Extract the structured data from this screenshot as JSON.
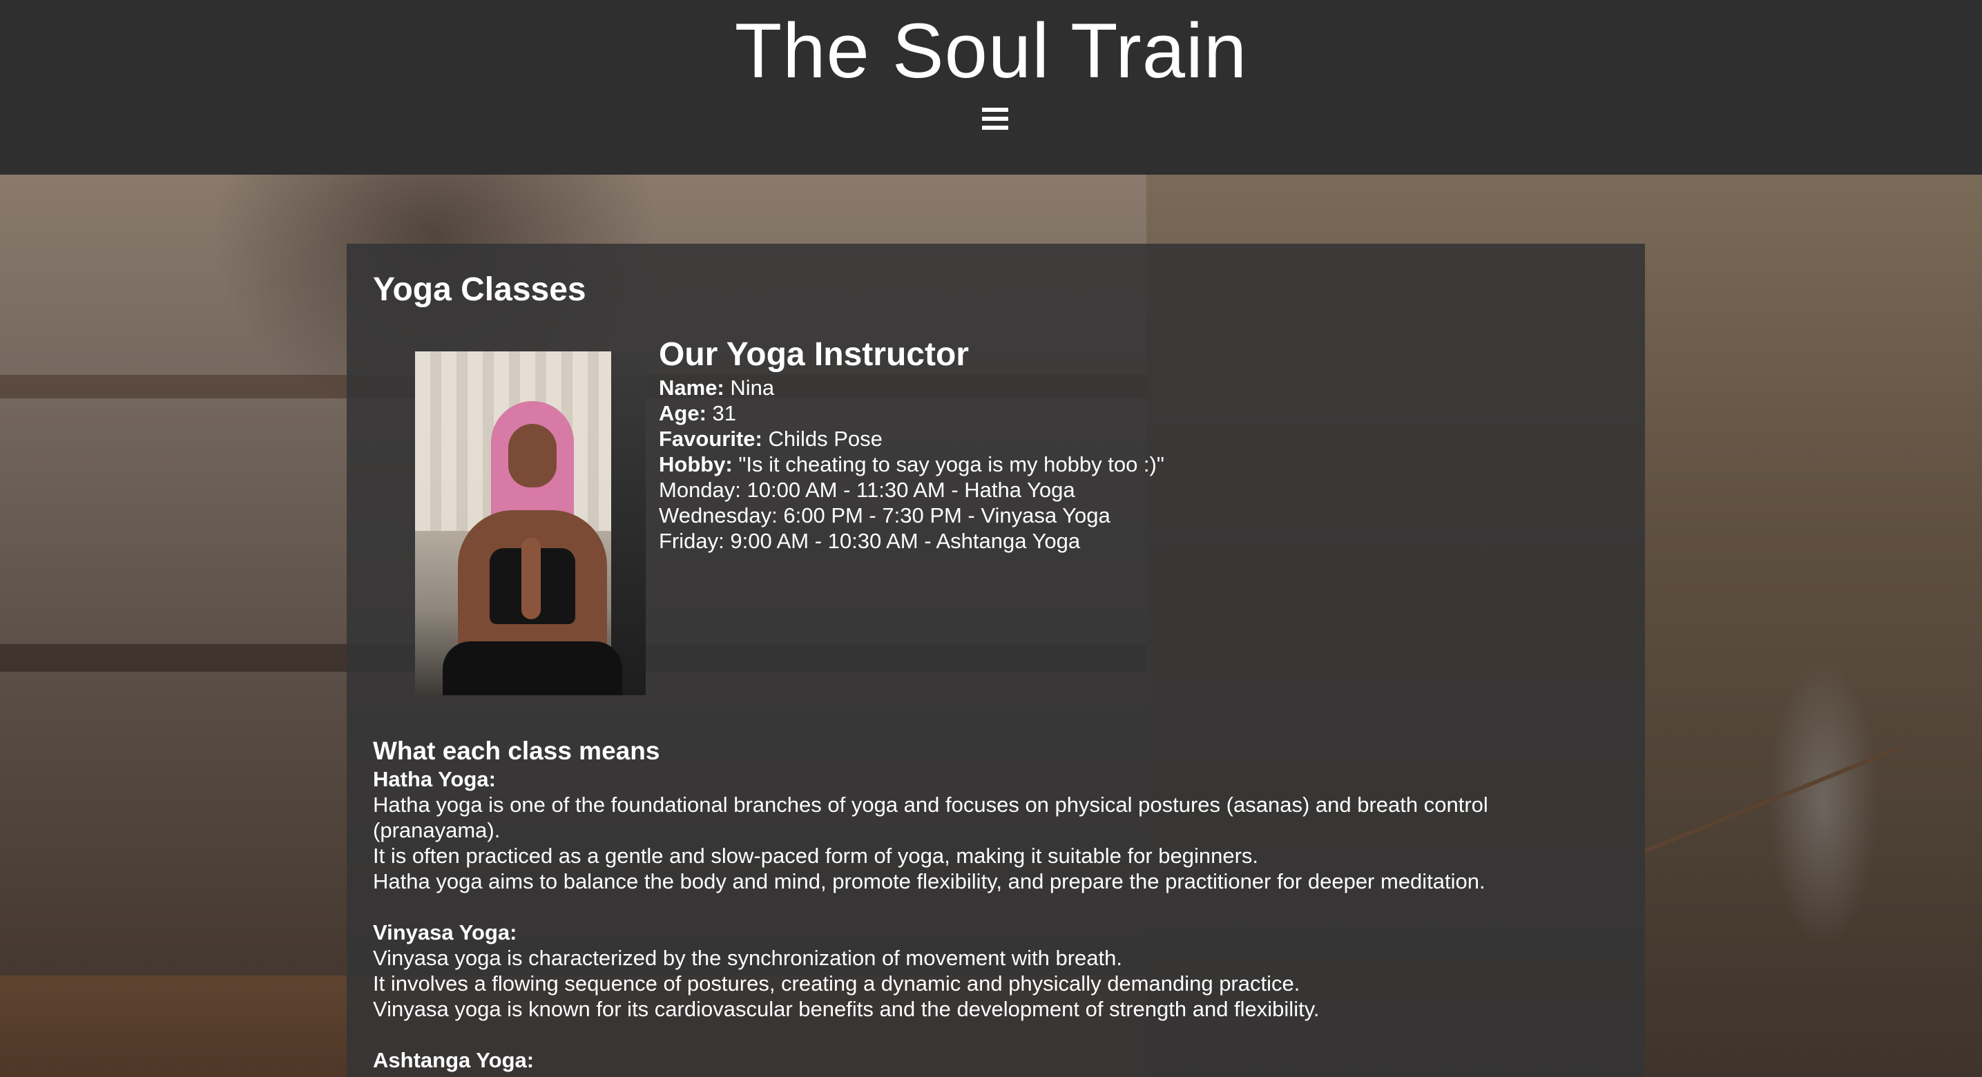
{
  "header": {
    "title": "The Soul Train",
    "menu_icon": "hamburger-menu-icon"
  },
  "main": {
    "section_title": "Yoga Classes",
    "instructor": {
      "heading": "Our Yoga Instructor",
      "name_label": "Name:",
      "name": "Nina",
      "age_label": "Age:",
      "age": "31",
      "favourite_label": "Favourite:",
      "favourite": "Childs Pose",
      "hobby_label": "Hobby:",
      "hobby": "\"Is it cheating to say yoga is my hobby too :)\"",
      "schedule": [
        "Monday: 10:00 AM - 11:30 AM - Hatha Yoga",
        "Wednesday: 6:00 PM - 7:30 PM - Vinyasa Yoga",
        "Friday: 9:00 AM - 10:30 AM - Ashtanga Yoga"
      ]
    },
    "classes": {
      "heading": "What each class means",
      "items": [
        {
          "name": "Hatha Yoga:",
          "lines": [
            "Hatha yoga is one of the foundational branches of yoga and focuses on physical postures (asanas) and breath control",
            "(pranayama).",
            "It is often practiced as a gentle and slow-paced form of yoga, making it suitable for beginners.",
            "Hatha yoga aims to balance the body and mind, promote flexibility, and prepare the practitioner for deeper meditation."
          ]
        },
        {
          "name": "Vinyasa Yoga:",
          "lines": [
            "Vinyasa yoga is characterized by the synchronization of movement with breath.",
            "It involves a flowing sequence of postures, creating a dynamic and physically demanding practice.",
            "Vinyasa yoga is known for its cardiovascular benefits and the development of strength and flexibility."
          ]
        },
        {
          "name": "Ashtanga Yoga:",
          "lines": []
        }
      ]
    }
  }
}
